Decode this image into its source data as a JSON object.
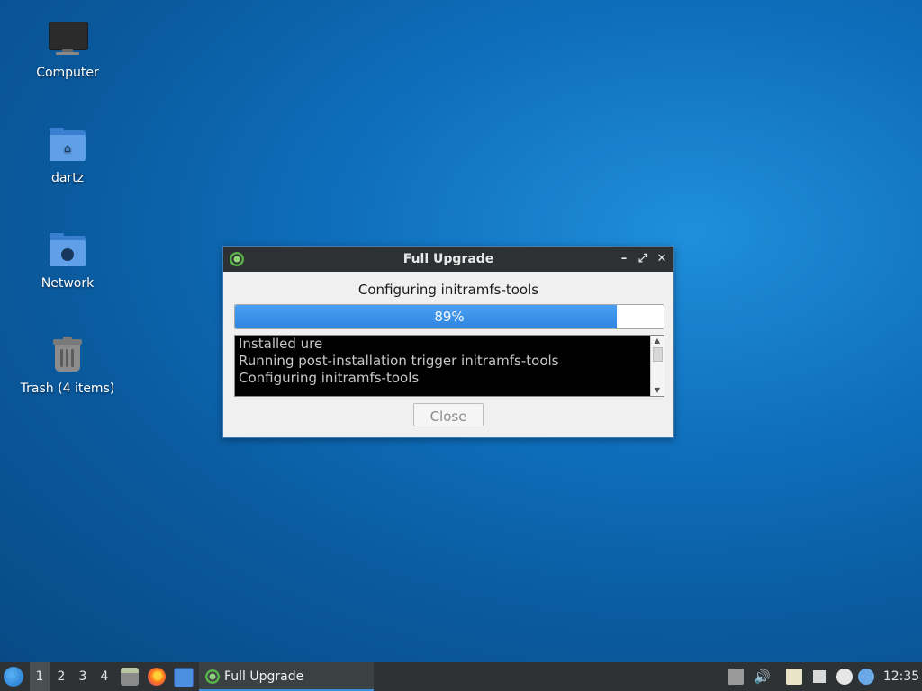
{
  "desktop": {
    "icons": [
      {
        "label": "Computer",
        "icon": "computer-icon"
      },
      {
        "label": "dartz",
        "icon": "home-folder-icon"
      },
      {
        "label": "Network",
        "icon": "network-folder-icon"
      },
      {
        "label": "Trash (4 items)",
        "icon": "trash-icon"
      }
    ]
  },
  "dialog": {
    "title": "Full Upgrade",
    "status": "Configuring initramfs-tools",
    "progress_percent": 89,
    "progress_label": "89%",
    "log_lines": [
      "Installed ure",
      "Running post-installation trigger initramfs-tools",
      "Configuring initramfs-tools"
    ],
    "close_label": "Close",
    "buttons": {
      "minimize": "–",
      "maximize": "⤢",
      "close": "✕"
    }
  },
  "taskbar": {
    "workspaces": [
      "1",
      "2",
      "3",
      "4"
    ],
    "active_workspace": "1",
    "launchers": [
      "file-manager-icon",
      "firefox-icon",
      "desktop-icon"
    ],
    "task_label": "Full Upgrade",
    "tray_icons": [
      "removable-media-icon",
      "volume-icon",
      "clipboard-icon",
      "network-icon",
      "update-icon",
      "notification-icon"
    ],
    "clock": "12:35"
  },
  "colors": {
    "accent": "#2f86e0",
    "titlebar": "#2e3133",
    "taskbar": "#2e3235"
  }
}
